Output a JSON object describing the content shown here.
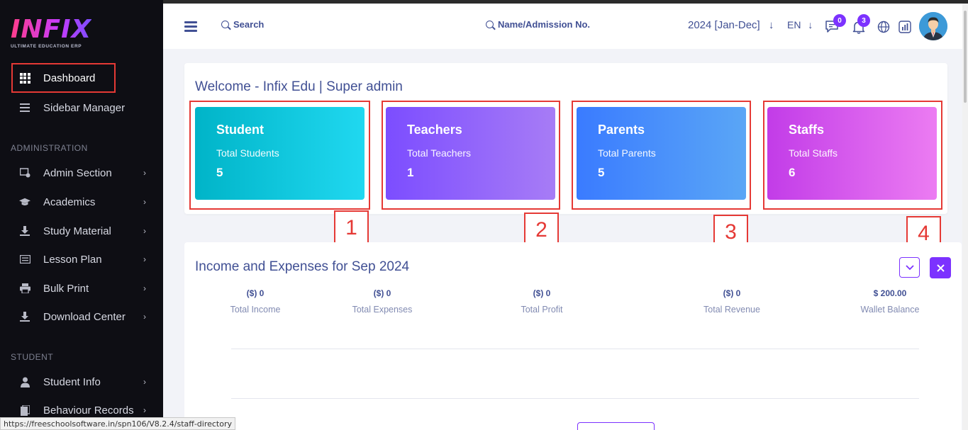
{
  "app": {
    "logo_text": "INFIX",
    "logo_sub": "ULTIMATE EDUCATION ERP"
  },
  "sidebar": {
    "items": [
      {
        "label": "Dashboard",
        "icon": "grid-icon"
      },
      {
        "label": "Sidebar Manager",
        "icon": "bars-icon"
      }
    ],
    "sections": [
      {
        "title": "ADMINISTRATION",
        "items": [
          {
            "label": "Admin Section",
            "icon": "admin-icon"
          },
          {
            "label": "Academics",
            "icon": "graduation-cap-icon"
          },
          {
            "label": "Study Material",
            "icon": "download-icon"
          },
          {
            "label": "Lesson Plan",
            "icon": "list-icon"
          },
          {
            "label": "Bulk Print",
            "icon": "printer-icon"
          },
          {
            "label": "Download Center",
            "icon": "download-icon"
          }
        ]
      },
      {
        "title": "STUDENT",
        "items": [
          {
            "label": "Student Info",
            "icon": "user-icon"
          },
          {
            "label": "Behaviour Records",
            "icon": "clipboard-icon"
          }
        ]
      }
    ]
  },
  "header": {
    "search_label": "Search",
    "student_search_label": "Name/Admission No.",
    "session": "2024 [Jan-Dec]",
    "language": "EN",
    "messages_count": "0",
    "notifications_count": "3"
  },
  "welcome": {
    "title": "Welcome - Infix Edu | Super admin",
    "cards": [
      {
        "title": "Student",
        "subtitle": "Total Students",
        "count": "5",
        "marker": "1",
        "gradient": [
          "#00b4c8",
          "#20d8f0"
        ]
      },
      {
        "title": "Teachers",
        "subtitle": "Total Teachers",
        "count": "1",
        "marker": "2",
        "gradient": [
          "#7c4dff",
          "#a77cf6"
        ]
      },
      {
        "title": "Parents",
        "subtitle": "Total Parents",
        "count": "5",
        "marker": "3",
        "gradient": [
          "#3a7bff",
          "#5aa6f6"
        ]
      },
      {
        "title": "Staffs",
        "subtitle": "Total Staffs",
        "count": "6",
        "marker": "4",
        "gradient": [
          "#c23ce8",
          "#ec7cf2"
        ]
      }
    ]
  },
  "income": {
    "title": "Income and Expenses for Sep 2024",
    "stats": [
      {
        "value": "($) 0",
        "label": "Total Income"
      },
      {
        "value": "($) 0",
        "label": "Total Expenses"
      },
      {
        "value": "($) 0",
        "label": "Total Profit"
      },
      {
        "value": "($) 0",
        "label": "Total Revenue"
      },
      {
        "value": "$ 200.00",
        "label": "Wallet Balance"
      }
    ]
  },
  "status_url": "https://freeschoolsoftware.in/spn106/V8.2.4/staff-directory",
  "colors": {
    "accent": "#7c32ff",
    "primary_text": "#415094",
    "sidebar_bg": "#0e0e14",
    "highlight": "#e53935"
  }
}
